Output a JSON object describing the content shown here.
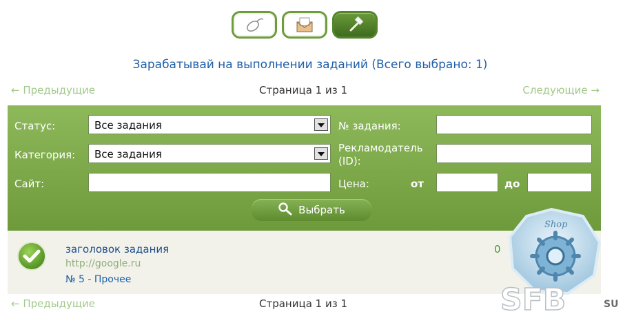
{
  "tabs": [
    {
      "id": "mouse",
      "icon": "mouse-icon",
      "active": false
    },
    {
      "id": "mail",
      "icon": "envelope-icon",
      "active": false
    },
    {
      "id": "tools",
      "icon": "hammer-icon",
      "active": true
    }
  ],
  "title": "Зарабатывай на выполнении заданий (Всего выбрано: 1)",
  "pager": {
    "prev": "← Предыдущие",
    "info": "Страница 1 из 1",
    "next": "Следующие →"
  },
  "filter": {
    "status_label": "Статус:",
    "status_value": "Все задания",
    "category_label": "Категория:",
    "category_value": "Все задания",
    "site_label": "Сайт:",
    "site_value": "",
    "task_no_label": "№ задания:",
    "task_no_value": "",
    "advertiser_label_1": "Рекламодатель",
    "advertiser_label_2": "(ID):",
    "advertiser_value": "",
    "price_label": "Цена:",
    "price_from_label": "от",
    "price_from_value": "",
    "price_to_label": "до",
    "price_to_value": "",
    "submit_label": "Выбрать"
  },
  "task": {
    "title": "заголовок задания",
    "url": "http://google.ru",
    "meta": "№ 5 - Прочее",
    "price_partial": "0"
  },
  "watermark": {
    "shop_text": "Shop",
    "brand_text": "SFB",
    "suffix_text": "SU"
  },
  "colors": {
    "accent_green": "#7aa84a",
    "link_blue": "#1f5fa8",
    "pager_green": "#a2c98a"
  }
}
